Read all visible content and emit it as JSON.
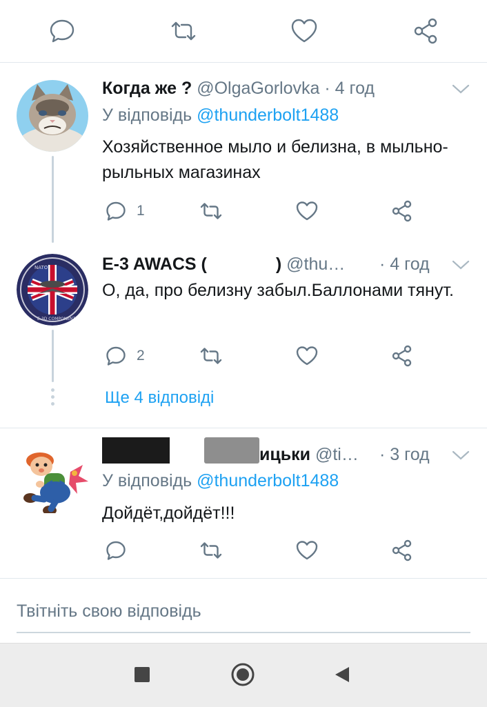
{
  "top_actions": {
    "icons": [
      "reply-icon",
      "retweet-icon",
      "like-icon",
      "share-icon"
    ]
  },
  "tweets": [
    {
      "name": "Когда же ?",
      "handle": "@OlgaGorlovka",
      "time": "· 4 год",
      "reply_prefix": "У відповідь",
      "reply_handle": "@thunderbolt1488",
      "text": "Хозяйственное мыло и белизна, в мыльно- рыльных магазинах",
      "reply_count": "1",
      "avatar": "grumpy-cat-avatar"
    },
    {
      "name_start": "E-3 AWACS (",
      "name_end": ")",
      "handle": "@thu…",
      "time": "· 4 год",
      "text": "О, да, про белизну забыл.Баллонами тянут.",
      "reply_count": "2",
      "avatar": "awacs-patch-avatar"
    },
    {
      "name_end": "ицьки",
      "handle": "@ti…",
      "time": "· 3 год",
      "reply_prefix": "У відповідь",
      "reply_handle": "@thunderbolt1488",
      "text": "Дойдёт,дойдёт!!!",
      "avatar": "carlson-cartoon-avatar"
    }
  ],
  "more_replies": "Ще 4 відповіді",
  "compose": {
    "placeholder": "Твітніть свою відповідь"
  },
  "colors": {
    "accent": "#1da1f2",
    "muted": "#657786",
    "text": "#14171a"
  }
}
